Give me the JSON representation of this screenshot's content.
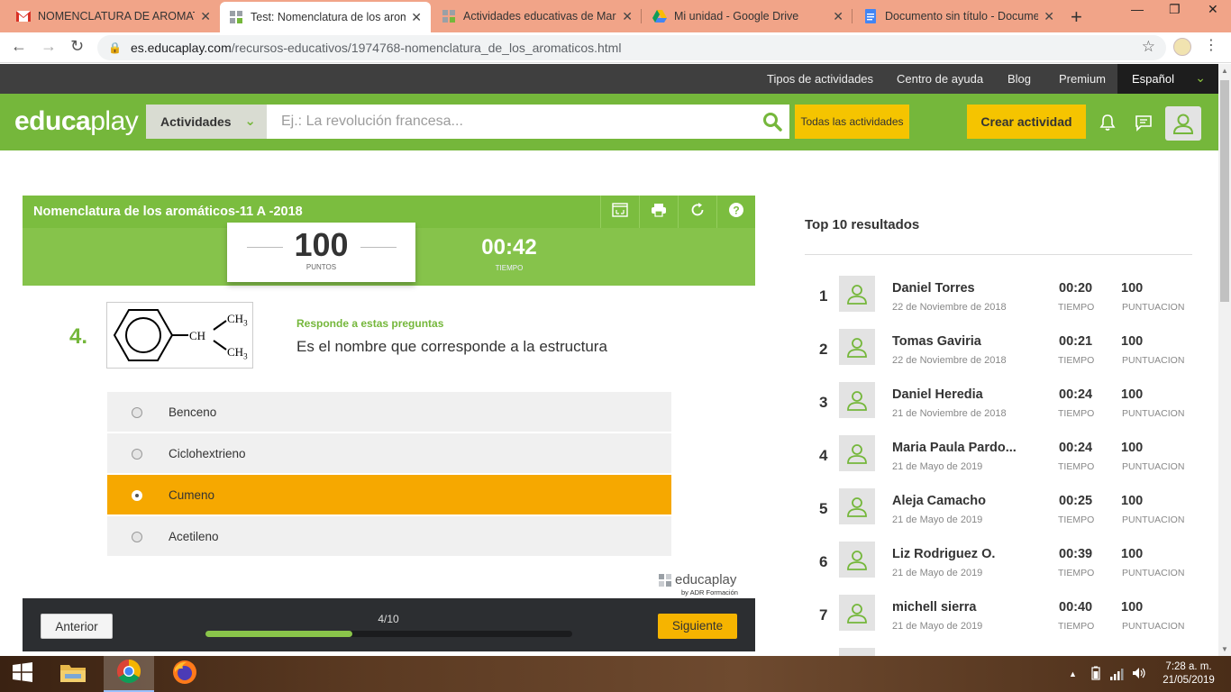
{
  "browser": {
    "tabs": [
      {
        "title": "NOMENCLATURA DE AROMATIC",
        "icon": "gmail-icon",
        "active": false
      },
      {
        "title": "Test: Nomenclatura de los arom",
        "icon": "educaplay-icon",
        "active": true
      },
      {
        "title": "Actividades educativas de Maria",
        "icon": "educaplay-icon",
        "active": false
      },
      {
        "title": "Mi unidad - Google Drive",
        "icon": "drive-icon",
        "active": false
      },
      {
        "title": "Documento sin título - Docume",
        "icon": "docs-icon",
        "active": false
      }
    ],
    "url_host": "es.educaplay.com",
    "url_path": "/recursos-educativos/1974768-nomenclatura_de_los_aromaticos.html"
  },
  "site": {
    "topnav": [
      "Tipos de actividades",
      "Centro de ayuda",
      "Blog",
      "Premium"
    ],
    "language": "Español",
    "logo_bold": "educa",
    "logo_light": "play",
    "activities_dropdown": "Actividades",
    "search_placeholder": "Ej.: La revolución francesa...",
    "all_activities": "Todas las actividades",
    "create_activity": "Crear actividad"
  },
  "activity": {
    "title": "Nomenclatura de los aromáticos-11 A -2018",
    "score": "100",
    "score_label": "PUNTOS",
    "timer": "00:42",
    "timer_label": "TIEMPO",
    "question_number": "4.",
    "instruction": "Responde a estas preguntas",
    "question": "Es el nombre que corresponde a la estructura",
    "formula_ch": "CH",
    "formula_ch3": "CH",
    "formula_sub": "3",
    "options": [
      {
        "label": "Benceno",
        "selected": false
      },
      {
        "label": "Ciclohextrieno",
        "selected": false
      },
      {
        "label": "Cumeno",
        "selected": true
      },
      {
        "label": "Acetileno",
        "selected": false
      }
    ],
    "brand_bold": "educa",
    "brand_light": "play",
    "brand_by": "by ADR Formación",
    "prev": "Anterior",
    "next": "Siguiente",
    "progress_text": "4/10",
    "progress_fraction": 0.4
  },
  "ranking": {
    "title": "Top 10 resultados",
    "time_label": "TIEMPO",
    "score_label": "PUNTUACION",
    "rows": [
      {
        "pos": "1",
        "name": "Daniel Torres",
        "date": "22 de Noviembre de 2018",
        "time": "00:20",
        "score": "100"
      },
      {
        "pos": "2",
        "name": "Tomas Gaviria",
        "date": "22 de Noviembre de 2018",
        "time": "00:21",
        "score": "100"
      },
      {
        "pos": "3",
        "name": "Daniel Heredia",
        "date": "21 de Noviembre de 2018",
        "time": "00:24",
        "score": "100"
      },
      {
        "pos": "4",
        "name": "Maria Paula Pardo...",
        "date": "21 de Mayo de 2019",
        "time": "00:24",
        "score": "100"
      },
      {
        "pos": "5",
        "name": "Aleja Camacho",
        "date": "21 de Mayo de 2019",
        "time": "00:25",
        "score": "100"
      },
      {
        "pos": "6",
        "name": "Liz Rodriguez O.",
        "date": "21 de Mayo de 2019",
        "time": "00:39",
        "score": "100"
      },
      {
        "pos": "7",
        "name": "michell sierra",
        "date": "21 de Mayo de 2019",
        "time": "00:40",
        "score": "100"
      }
    ]
  },
  "taskbar": {
    "time": "7:28 a. m.",
    "date": "21/05/2019"
  },
  "colors": {
    "brand_green": "#75b73b",
    "accent_yellow": "#f5c400",
    "selected_orange": "#f6a800"
  }
}
